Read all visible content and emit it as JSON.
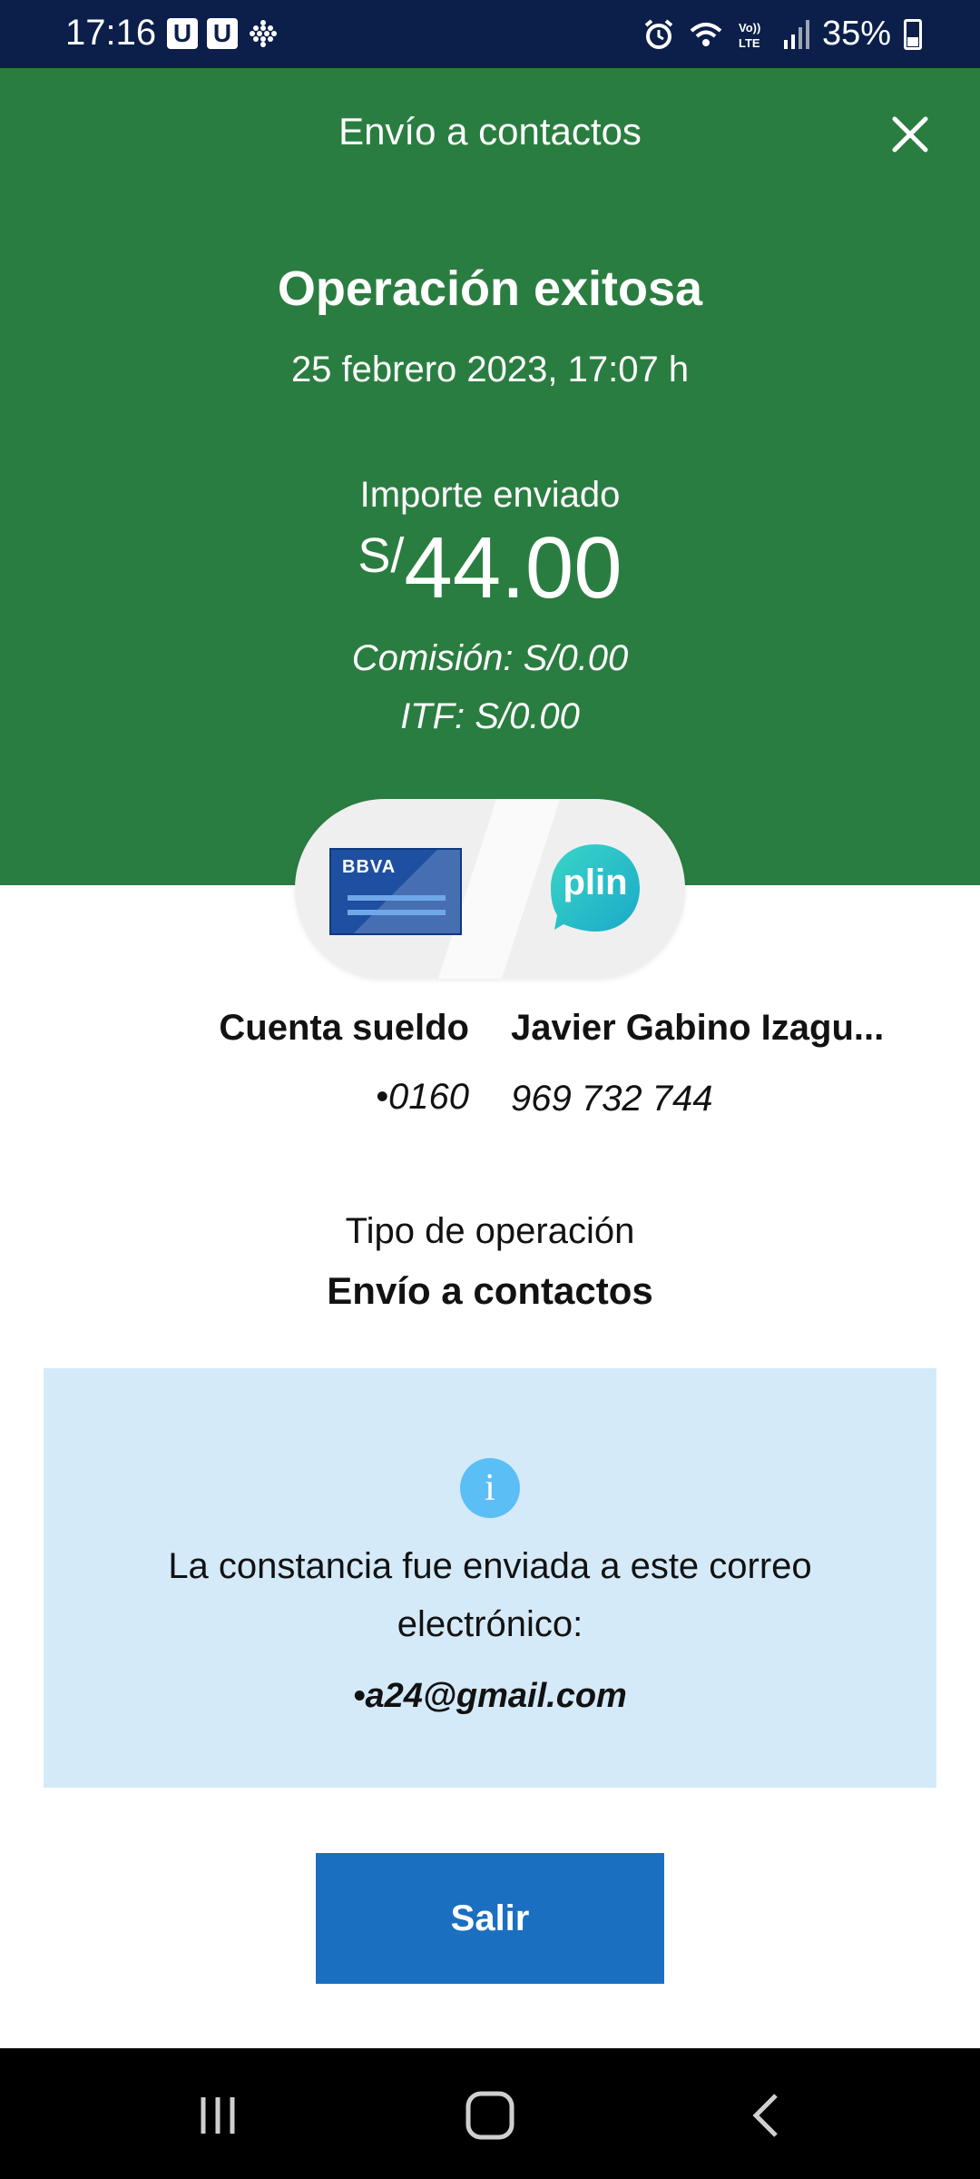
{
  "status_bar": {
    "time": "17:16",
    "battery_percent": "35%",
    "u_icon_letter": "U"
  },
  "header": {
    "title": "Envío a contactos",
    "operation_title": "Operación exitosa",
    "datetime": "25 febrero 2023, 17:07 h",
    "amount_label": "Importe enviado",
    "currency": "S/",
    "amount": "44.00",
    "commission": "Comisión:  S/0.00",
    "itf": "ITF:  S/0.00"
  },
  "origin": {
    "bank_logo_text": "BBVA",
    "name": "Cuenta sueldo",
    "account": "•0160"
  },
  "destination": {
    "app_logo_text": "plin",
    "name": "Javier Gabino Izagu...",
    "phone": "969 732 744"
  },
  "operation_type": {
    "label": "Tipo de operación",
    "value": "Envío a contactos"
  },
  "info": {
    "message": "La constancia fue enviada a este correo electrónico:",
    "email": "•a24@gmail.com"
  },
  "actions": {
    "exit_label": "Salir"
  },
  "colors": {
    "header_bg": "#2a7d40",
    "status_bar_bg": "#0b1f4a",
    "button_bg": "#1a6fc0",
    "info_bg": "#d4eaf9"
  }
}
